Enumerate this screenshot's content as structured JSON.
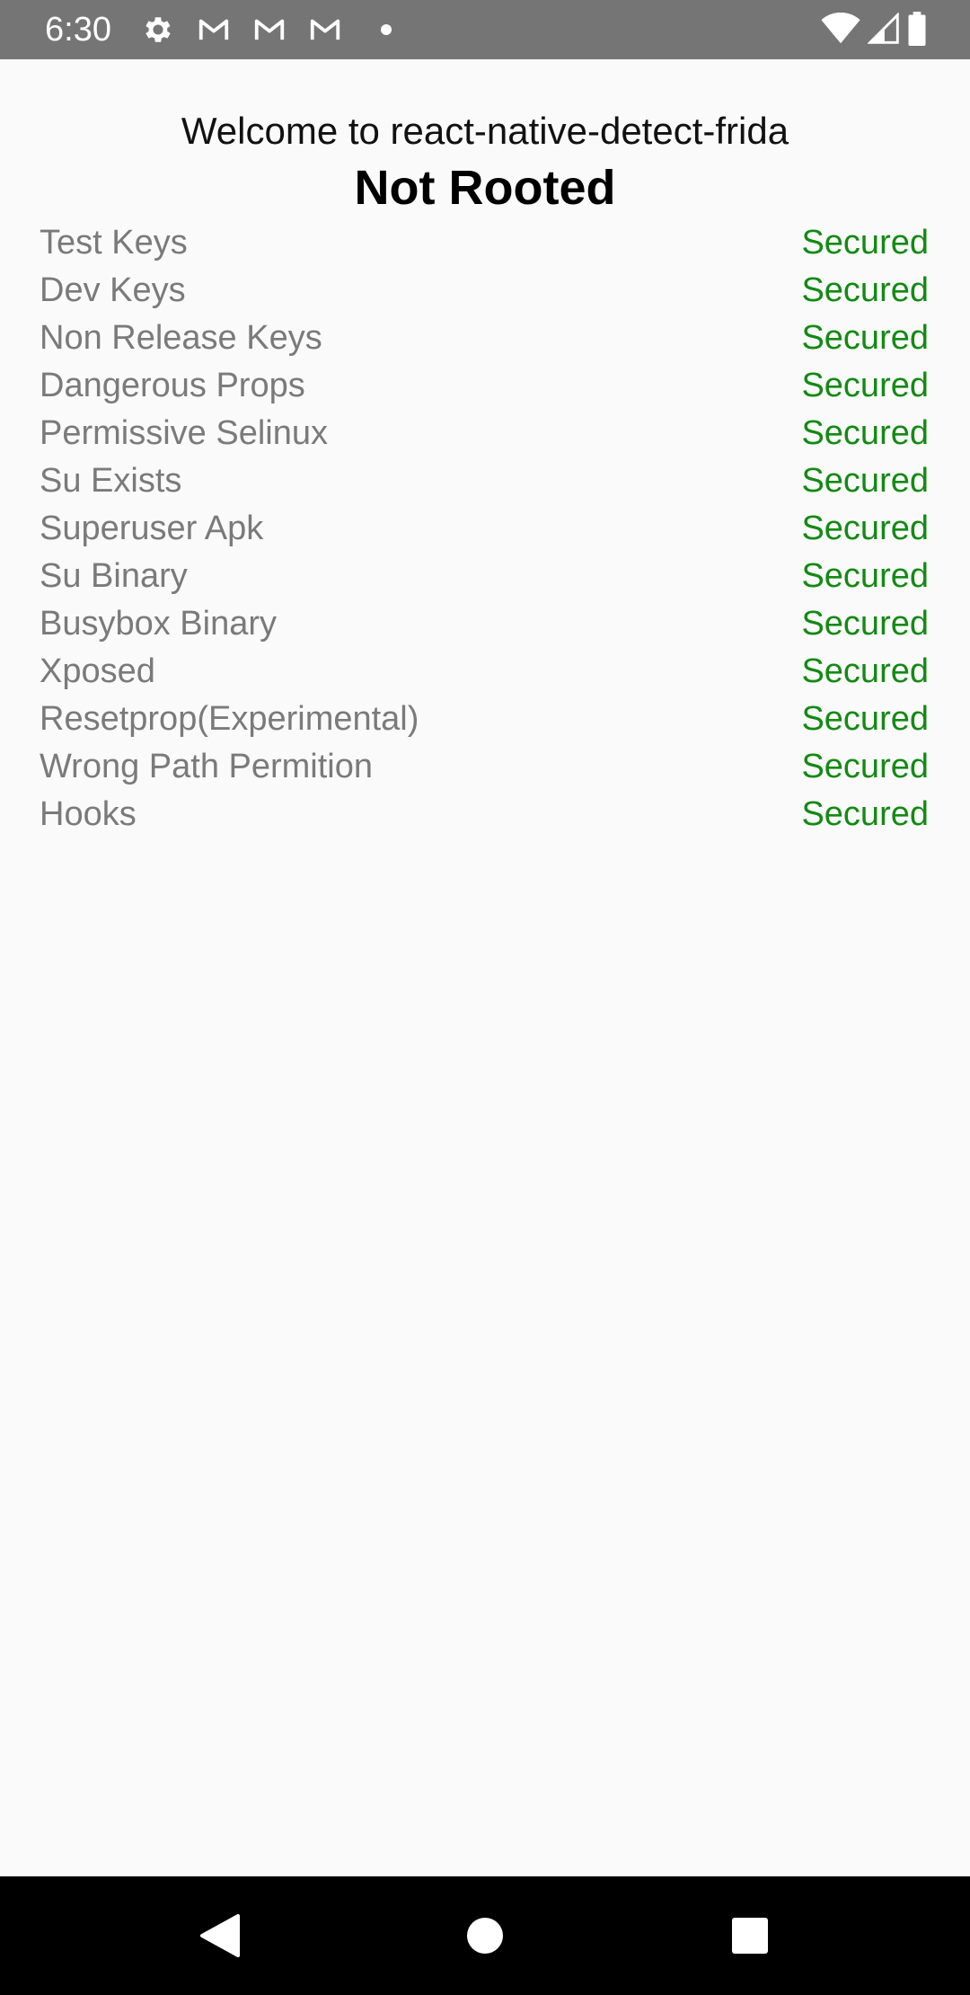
{
  "status_bar": {
    "time": "6:30",
    "left_icons": [
      "gear-icon",
      "gmail-icon",
      "gmail-icon",
      "gmail-icon",
      "notification-dot-icon"
    ],
    "right_icons": [
      "wifi-icon",
      "cell-signal-icon",
      "battery-icon"
    ]
  },
  "main": {
    "welcome": "Welcome to react-native-detect-frida",
    "root_status": "Not Rooted",
    "checks": [
      {
        "label": "Test Keys",
        "value": "Secured"
      },
      {
        "label": "Dev Keys",
        "value": "Secured"
      },
      {
        "label": "Non Release Keys",
        "value": "Secured"
      },
      {
        "label": "Dangerous Props",
        "value": "Secured"
      },
      {
        "label": "Permissive Selinux",
        "value": "Secured"
      },
      {
        "label": "Su Exists",
        "value": "Secured"
      },
      {
        "label": "Superuser Apk",
        "value": "Secured"
      },
      {
        "label": "Su Binary",
        "value": "Secured"
      },
      {
        "label": "Busybox Binary",
        "value": "Secured"
      },
      {
        "label": "Xposed",
        "value": "Secured"
      },
      {
        "label": "Resetprop(Experimental)",
        "value": "Secured"
      },
      {
        "label": "Wrong Path Permition",
        "value": "Secured"
      },
      {
        "label": "Hooks",
        "value": "Secured"
      }
    ]
  },
  "nav_bar": {
    "buttons": [
      "back-icon",
      "home-icon",
      "recents-icon"
    ]
  },
  "colors": {
    "status_bar_bg": "#757575",
    "label_text": "#7a7a7a",
    "secured_text": "#138a13",
    "nav_bar_bg": "#000000"
  }
}
